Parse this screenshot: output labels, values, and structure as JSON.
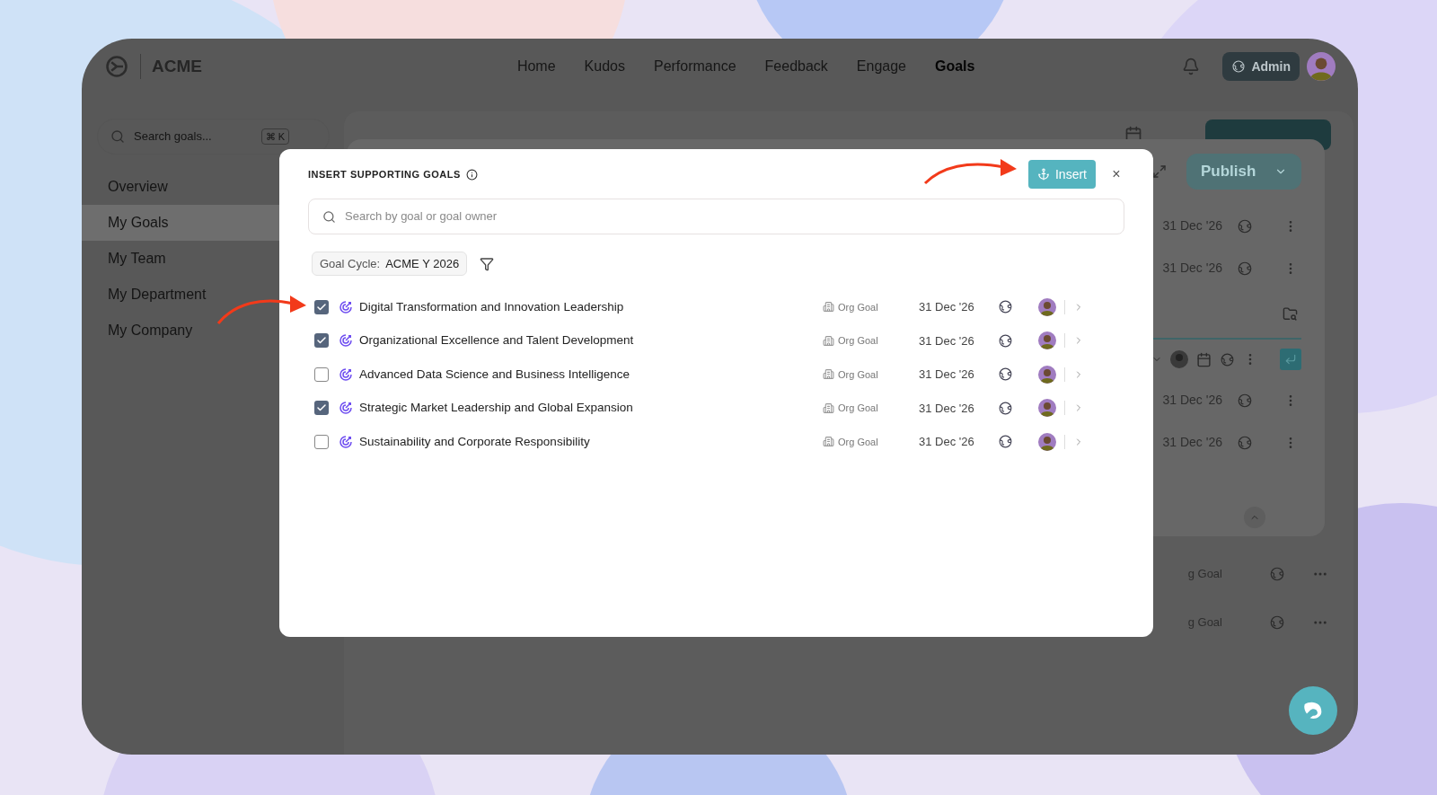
{
  "nav": {
    "brand": "ACME",
    "links": [
      {
        "label": "Home",
        "selected": false
      },
      {
        "label": "Kudos",
        "selected": false
      },
      {
        "label": "Performance",
        "selected": false
      },
      {
        "label": "Feedback",
        "selected": false
      },
      {
        "label": "Engage",
        "selected": false
      },
      {
        "label": "Goals",
        "selected": true
      }
    ],
    "admin": "Admin"
  },
  "sidebar": {
    "search": {
      "placeholder": "Search goals...",
      "shortcut": "⌘ K"
    },
    "items": [
      {
        "label": "Overview",
        "selected": false
      },
      {
        "label": "My Goals",
        "selected": true
      },
      {
        "label": "My Team",
        "selected": false
      },
      {
        "label": "My Department",
        "selected": false
      },
      {
        "label": "My Company",
        "selected": false
      }
    ]
  },
  "background_dialog": {
    "publish": "Publish",
    "rows": [
      {
        "kind": "date",
        "date": "31 Dec '26"
      },
      {
        "kind": "date",
        "date": "31 Dec '26"
      },
      {
        "kind": "folder"
      },
      {
        "kind": "editor"
      },
      {
        "kind": "date",
        "date": "31 Dec '26"
      },
      {
        "kind": "date",
        "date": "31 Dec '26"
      }
    ]
  },
  "background_list": [
    {
      "type": "g Goal"
    },
    {
      "type": "g Goal"
    }
  ],
  "modal": {
    "title": "INSERT SUPPORTING GOALS",
    "insert": "Insert",
    "close": "×",
    "search_placeholder": "Search by goal or goal owner",
    "filter": {
      "label": "Goal Cycle:",
      "value": "ACME Y 2026"
    },
    "goals": [
      {
        "title": "Digital Transformation and Innovation Leadership",
        "checked": true,
        "type": "Org Goal",
        "date": "31 Dec '26"
      },
      {
        "title": "Organizational Excellence and Talent Development",
        "checked": true,
        "type": "Org Goal",
        "date": "31 Dec '26"
      },
      {
        "title": "Advanced Data Science and Business Intelligence",
        "checked": false,
        "type": "Org Goal",
        "date": "31 Dec '26"
      },
      {
        "title": "Strategic Market Leadership and Global Expansion",
        "checked": true,
        "type": "Org Goal",
        "date": "31 Dec '26"
      },
      {
        "title": "Sustainability and Corporate Responsibility",
        "checked": false,
        "type": "Org Goal",
        "date": "31 Dec '26"
      }
    ]
  }
}
